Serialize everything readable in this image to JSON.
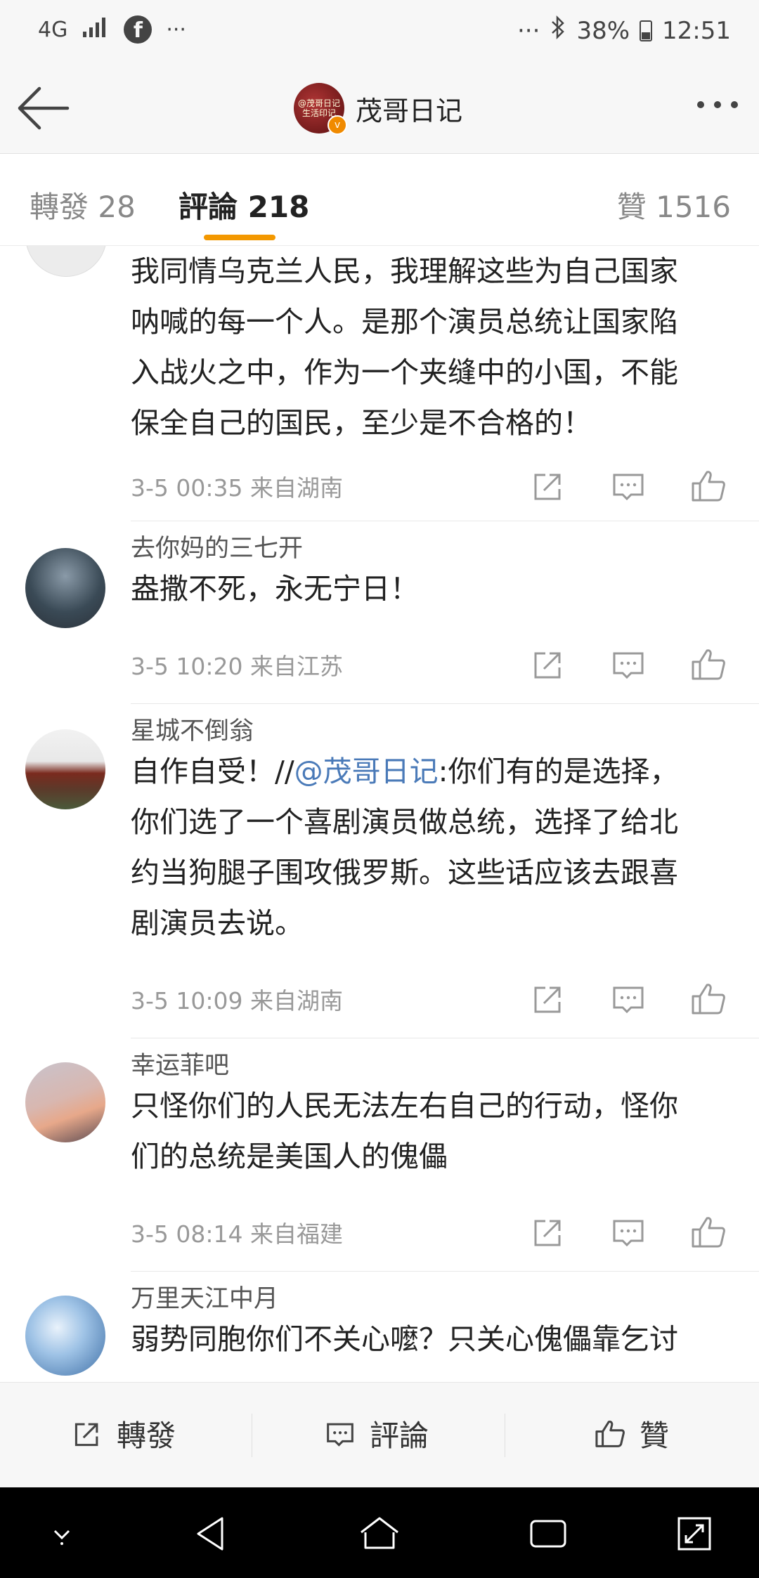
{
  "status_bar": {
    "network": "4G",
    "signal": "signal-icon",
    "facebook": "f",
    "dots_left": "···",
    "dots_right": "···",
    "battery": "38%",
    "time": "12:51"
  },
  "header": {
    "title": "茂哥日记",
    "avatar_text": "@茂哥日记 生活印记"
  },
  "tabs": [
    {
      "label": "轉發 28"
    },
    {
      "label": "評論 218"
    },
    {
      "label": "贊 1516"
    }
  ],
  "comments": [
    {
      "user": "",
      "lines": [
        "我同情乌克兰人民，我理解这些为自己国家",
        "呐喊的每一个人。是那个演员总统让国家陷",
        "入战火之中，作为一个夹缝中的小国，不能",
        "保全自己的国民，至少是不合格的！"
      ],
      "meta": "3-5 00:35  来自湖南"
    },
    {
      "user": "去你妈的三七开",
      "lines": [
        "盎撒不死，永无宁日！"
      ],
      "meta": "3-5 10:20  来自江苏"
    },
    {
      "user": "星城不倒翁",
      "line1_prefix": "自作自受！//",
      "line1_mention": "@茂哥日记",
      "line1_suffix": ":你们有的是选择，",
      "lines": [
        "你们选了一个喜剧演员做总统，选择了给北",
        "约当狗腿子围攻俄罗斯。这些话应该去跟喜",
        "剧演员去说。"
      ],
      "meta": "3-5 10:09  来自湖南"
    },
    {
      "user": "幸运菲吧",
      "lines": [
        "只怪你们的人民无法左右自己的行动，怪你",
        "们的总统是美国人的傀儡"
      ],
      "meta": "3-5 08:14  来自福建"
    },
    {
      "user": "万里天江中月",
      "lines": [
        "弱势同胞你们不关心嚒？只关心傀儡靠乞讨"
      ],
      "meta": ""
    }
  ],
  "bottom_bar": {
    "repost": "轉發",
    "comment": "評論",
    "like": "贊"
  },
  "colors": {
    "accent": "#f39800",
    "mention": "#4a7ab8"
  }
}
